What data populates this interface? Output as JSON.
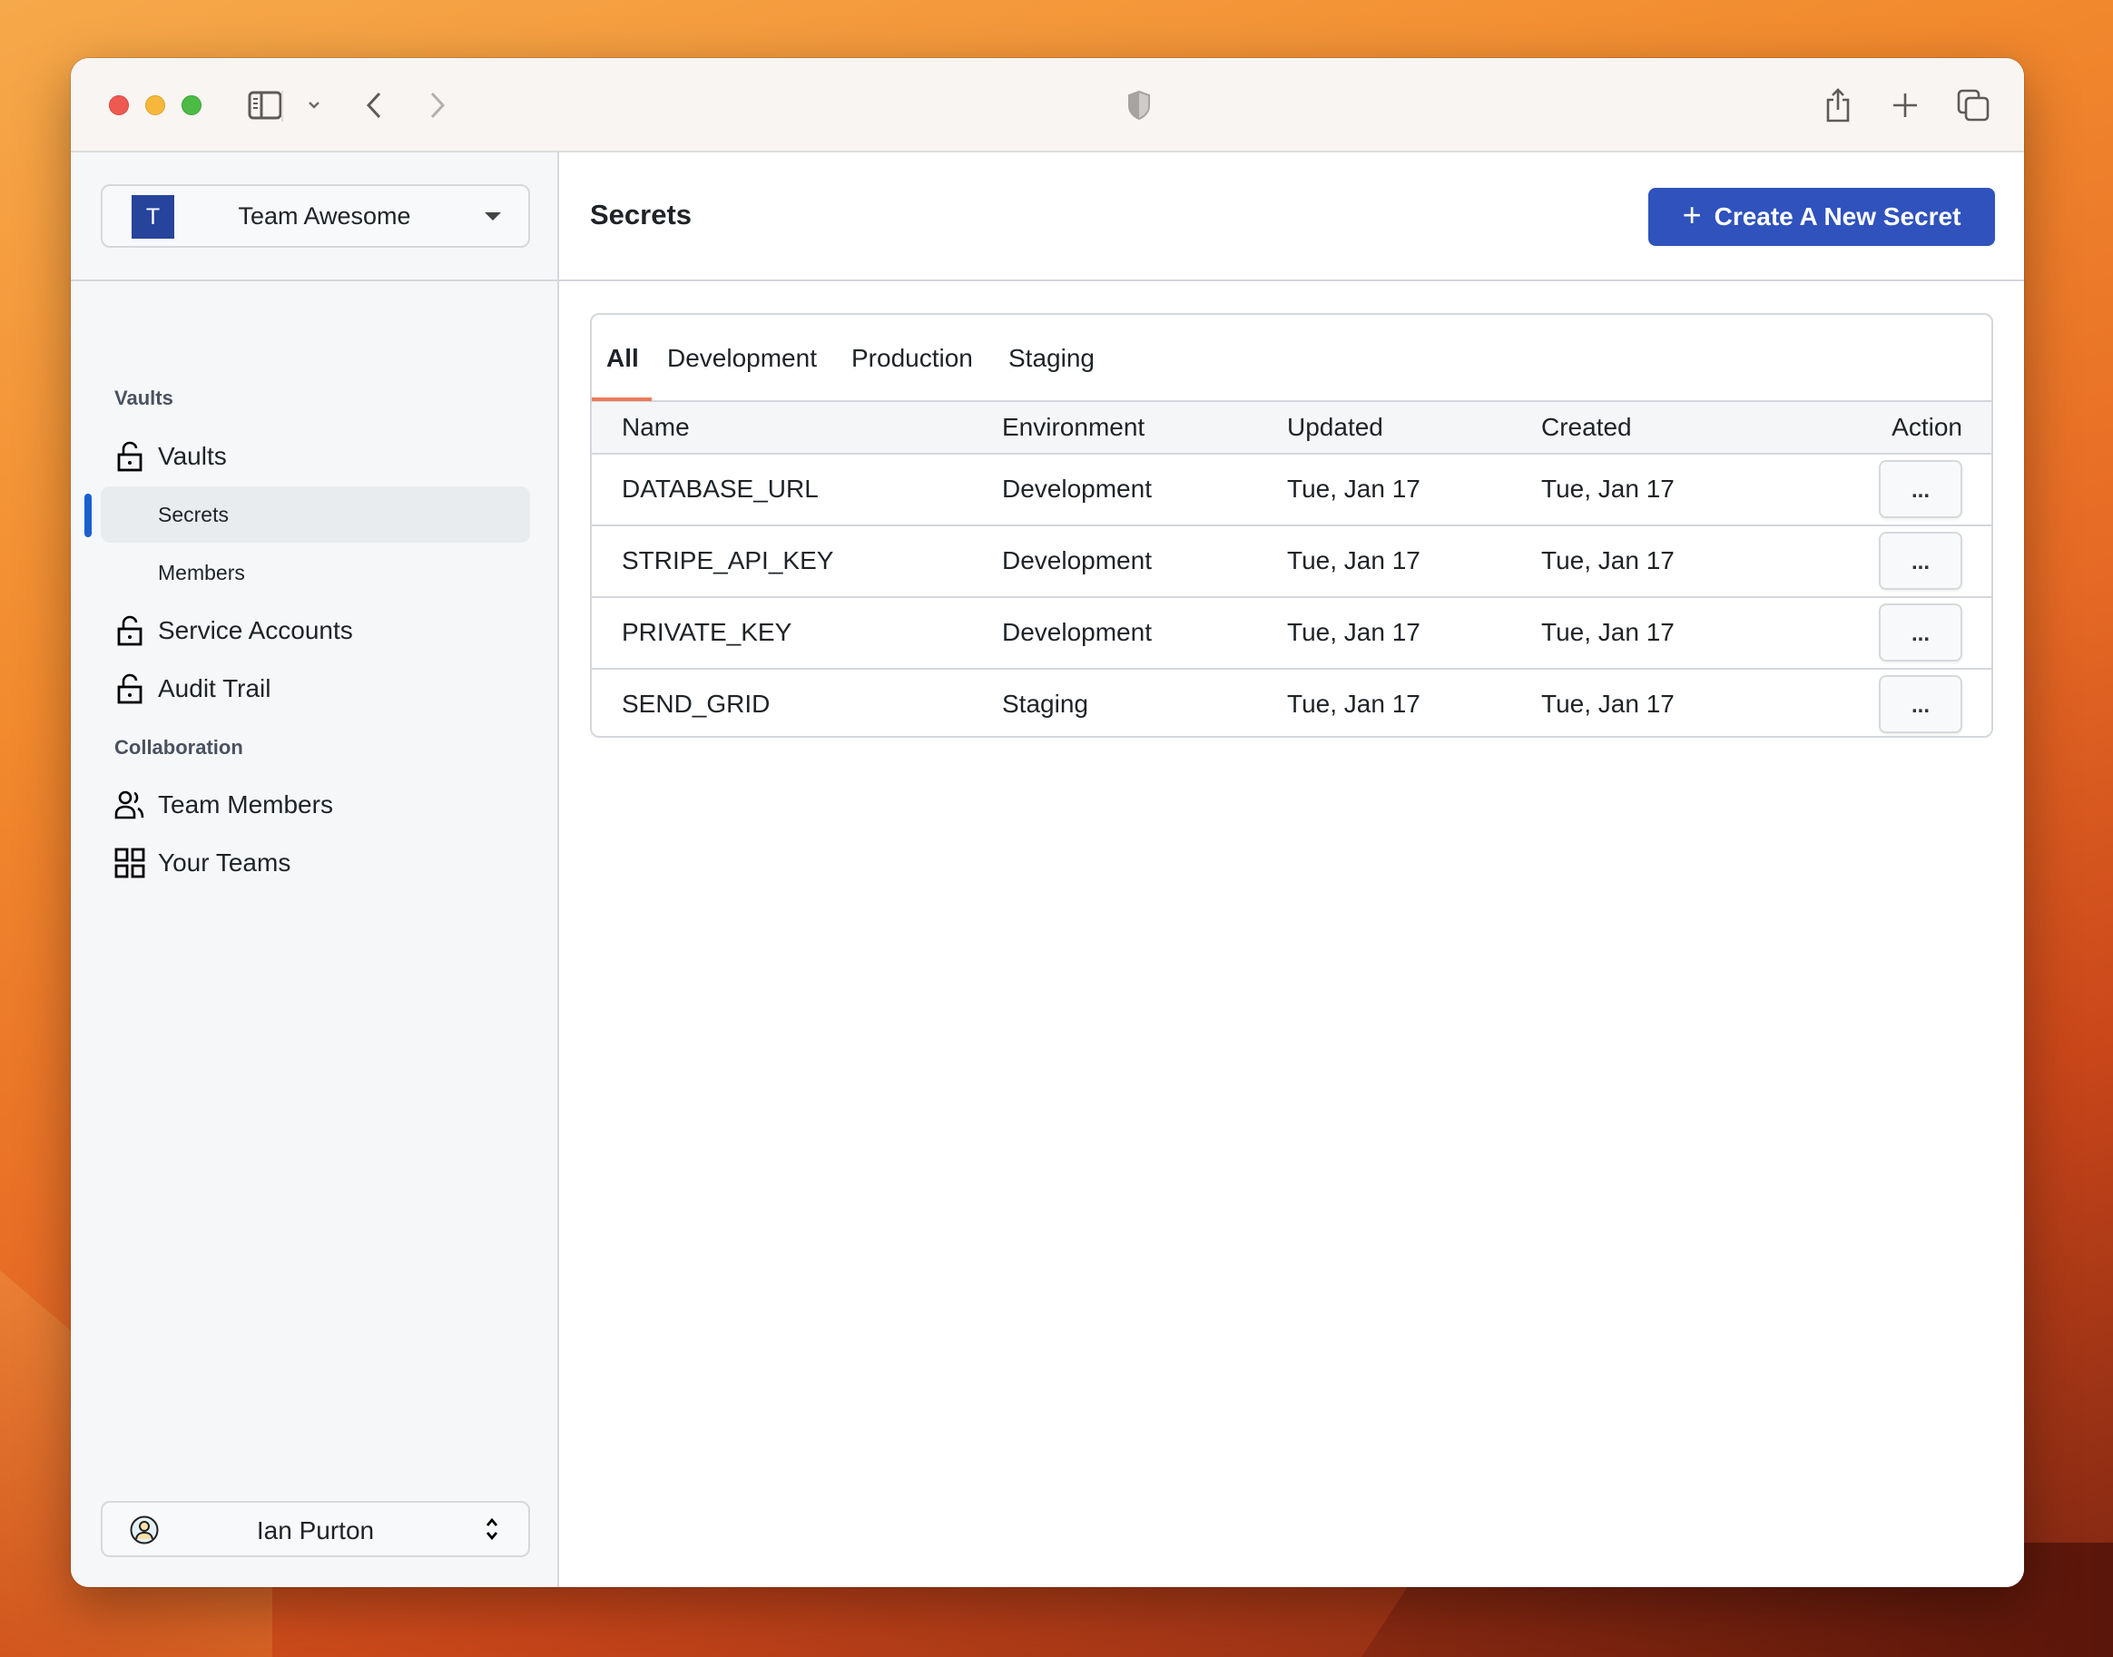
{
  "browser": {
    "icons": [
      "sidebar-toggle-icon",
      "chevron-down-icon",
      "back-icon",
      "forward-icon",
      "privacy-shield-icon",
      "share-icon",
      "new-tab-icon",
      "tab-overview-icon"
    ]
  },
  "sidebar": {
    "team": {
      "initial": "T",
      "name": "Team Awesome",
      "badge_color": "#26449b"
    },
    "sections": [
      {
        "title": "Vaults"
      },
      {
        "title": "Collaboration"
      }
    ],
    "items": [
      {
        "label": "Vaults",
        "icon": "unlock-icon"
      },
      {
        "label": "Secrets",
        "active": true
      },
      {
        "label": "Members"
      },
      {
        "label": "Service Accounts",
        "icon": "unlock-icon"
      },
      {
        "label": "Audit Trail",
        "icon": "unlock-icon"
      },
      {
        "label": "Team Members",
        "icon": "users-icon"
      },
      {
        "label": "Your Teams",
        "icon": "grid-icon"
      }
    ],
    "active_indicator_color": "#1a5fd0",
    "user": {
      "name": "Ian Purton"
    }
  },
  "main": {
    "title": "Secrets",
    "create_button": {
      "label": "Create A New Secret",
      "icon": "plus-icon",
      "color": "#2f52bd"
    },
    "tabs": [
      {
        "label": "All",
        "active": true
      },
      {
        "label": "Development"
      },
      {
        "label": "Production"
      },
      {
        "label": "Staging"
      }
    ],
    "tab_accent_color": "#ee7a5a",
    "table": {
      "columns": [
        "Name",
        "Environment",
        "Updated",
        "Created",
        "Action"
      ],
      "rows": [
        {
          "name": "DATABASE_URL",
          "environment": "Development",
          "updated": "Tue, Jan 17",
          "created": "Tue, Jan 17",
          "action": "..."
        },
        {
          "name": "STRIPE_API_KEY",
          "environment": "Development",
          "updated": "Tue, Jan 17",
          "created": "Tue, Jan 17",
          "action": "..."
        },
        {
          "name": "PRIVATE_KEY",
          "environment": "Development",
          "updated": "Tue, Jan 17",
          "created": "Tue, Jan 17",
          "action": "..."
        },
        {
          "name": "SEND_GRID",
          "environment": "Staging",
          "updated": "Tue, Jan 17",
          "created": "Tue, Jan 17",
          "action": "..."
        }
      ]
    }
  }
}
